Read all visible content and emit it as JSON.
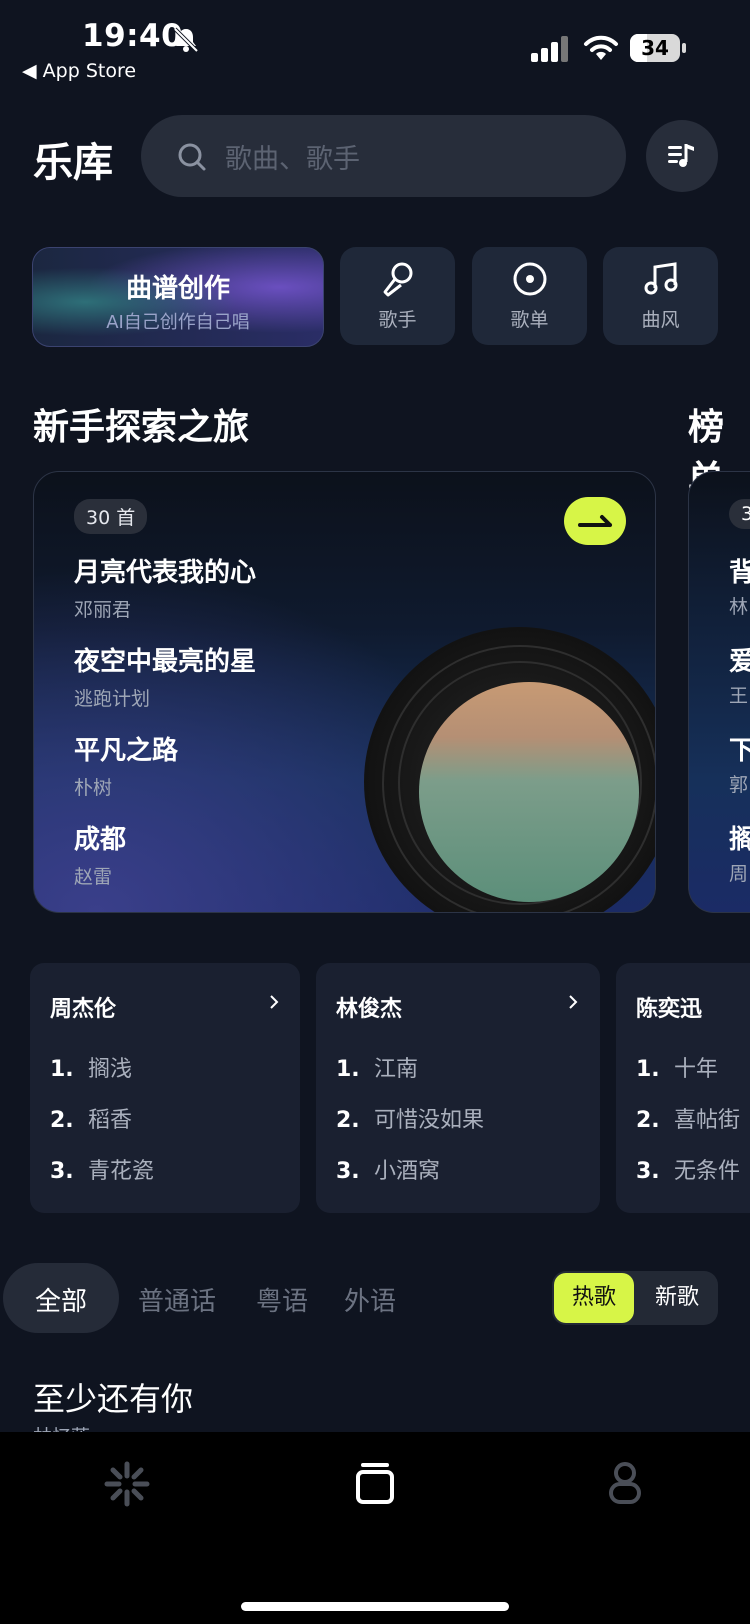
{
  "status_bar": {
    "time": "19:40",
    "back_label": "App Store",
    "battery": "34"
  },
  "header": {
    "title": "乐库",
    "search_placeholder": "歌曲、歌手"
  },
  "categories": {
    "create": {
      "title": "曲谱创作",
      "subtitle": "AI自己创作自己唱"
    },
    "items": [
      {
        "label": "歌手",
        "icon": "microphone-icon"
      },
      {
        "label": "歌单",
        "icon": "disc-icon"
      },
      {
        "label": "曲风",
        "icon": "music-note-icon"
      }
    ]
  },
  "sections": {
    "journey_title": "新手探索之旅",
    "charts_title": "榜单"
  },
  "journey_card": {
    "count": "30 首",
    "songs": [
      {
        "title": "月亮代表我的心",
        "artist": "邓丽君"
      },
      {
        "title": "夜空中最亮的星",
        "artist": "逃跑计划"
      },
      {
        "title": "平凡之路",
        "artist": "朴树"
      },
      {
        "title": "成都",
        "artist": "赵雷"
      }
    ]
  },
  "second_card": {
    "count": "3",
    "titles": [
      "背",
      "爱",
      "下",
      "搁"
    ],
    "artists": [
      "林",
      "王",
      "郭",
      "周"
    ]
  },
  "artists": [
    {
      "name": "周杰伦",
      "songs": [
        "搁浅",
        "稻香",
        "青花瓷"
      ]
    },
    {
      "name": "林俊杰",
      "songs": [
        "江南",
        "可惜没如果",
        "小酒窝"
      ]
    },
    {
      "name": "陈奕迅",
      "songs": [
        "十年",
        "喜帖街",
        "无条件"
      ]
    }
  ],
  "rank_labels": [
    "1.",
    "2.",
    "3."
  ],
  "filters": {
    "tabs": [
      "全部",
      "普通话",
      "粤语",
      "外语"
    ],
    "toggle": [
      "热歌",
      "新歌"
    ]
  },
  "list": {
    "first_title": "至少还有你",
    "first_artist": "林忆莲"
  },
  "colors": {
    "accent": "#d7f547",
    "background": "#0f1420"
  }
}
